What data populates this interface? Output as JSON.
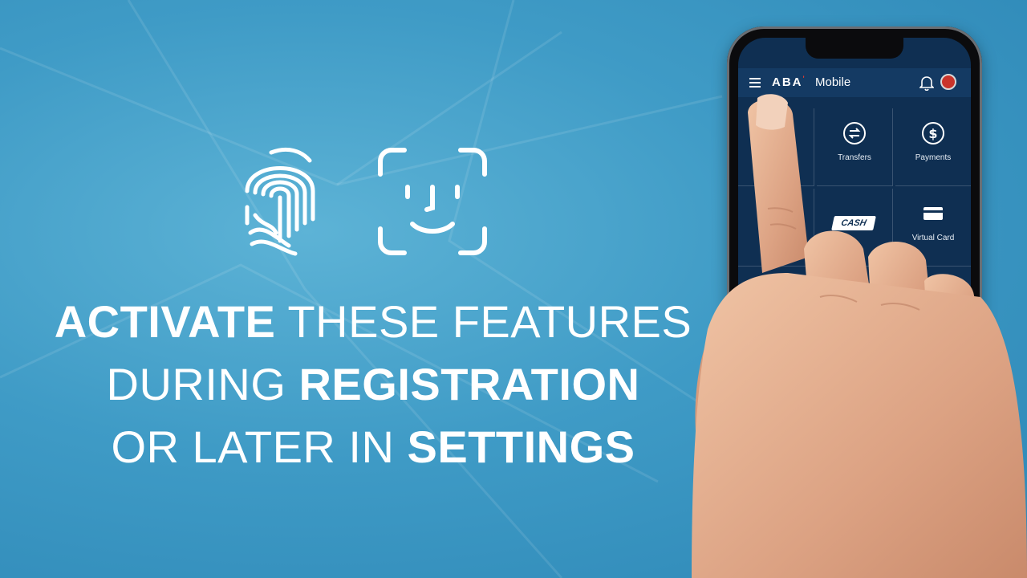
{
  "headline": {
    "line1_bold": "ACTIVATE",
    "line1_light": "THESE FEATURES",
    "line2_light": "DURING",
    "line2_bold": "REGISTRATION",
    "line3_light": "OR LATER IN",
    "line3_bold": "SETTINGS"
  },
  "icons": {
    "fingerprint": "fingerprint-icon",
    "face": "face-id-icon"
  },
  "app": {
    "brand": "ABA",
    "brand_accent": "'",
    "brand_sub": "Mobile",
    "tiles": [
      {
        "label": "Transfers",
        "icon": "transfer-icon"
      },
      {
        "label": "Payments",
        "icon": "dollar-icon"
      },
      {
        "label": "CASH",
        "icon": "ecash-icon"
      },
      {
        "label": "Virtual Card",
        "icon": "card-icon"
      }
    ]
  },
  "colors": {
    "background": "#3f9bc6",
    "app_bar": "#143a63",
    "app_screen": "#0f2f52",
    "brand_accent": "#e63b2e"
  }
}
